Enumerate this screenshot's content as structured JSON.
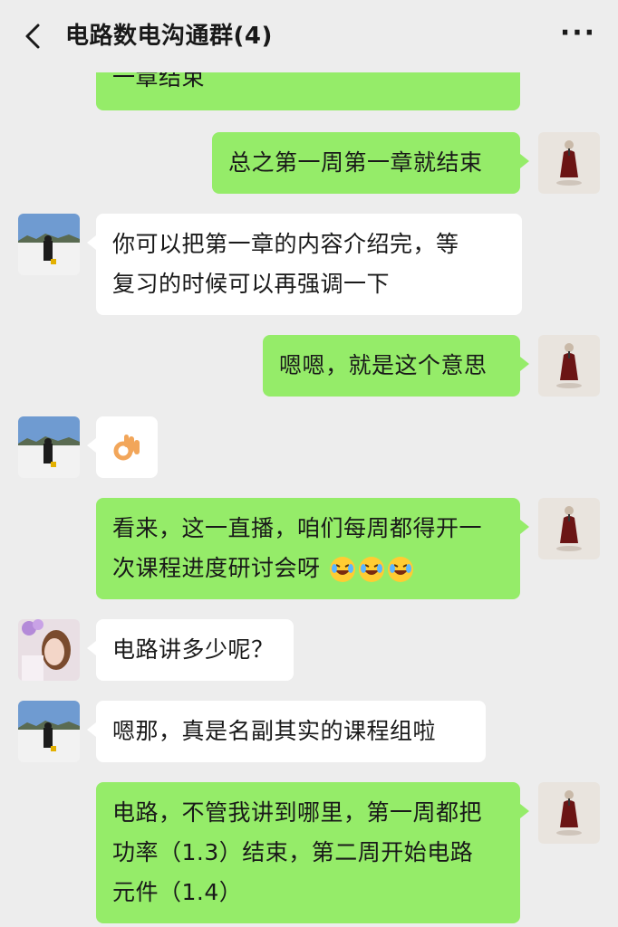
{
  "header": {
    "title": "电路数电沟通群(4)",
    "back_icon": "chevron-left-icon",
    "more_label": "···"
  },
  "messages": [
    {
      "side": "right",
      "type": "text",
      "text": "一章结束"
    },
    {
      "side": "right",
      "type": "text",
      "text": "总之第一周第一章就结束"
    },
    {
      "side": "left",
      "type": "text",
      "lines": [
        "你可以把第一章的内容介绍完，等",
        "复习的时候可以再强调一下"
      ]
    },
    {
      "side": "right",
      "type": "text",
      "text": "嗯嗯，就是这个意思"
    },
    {
      "side": "left",
      "type": "emoji",
      "emoji": "ok-hand-icon"
    },
    {
      "side": "right",
      "type": "text",
      "lines": [
        "看来，这一直播，咱们每周都得开一",
        "次课程进度研讨会呀"
      ],
      "trailing_emoji": "rofl-icon",
      "trailing_emoji_count": 3
    },
    {
      "side": "left",
      "type": "text",
      "text": "电路讲多少呢？"
    },
    {
      "side": "left",
      "type": "text",
      "text": "嗯那，真是名副其实的课程组啦"
    },
    {
      "side": "right",
      "type": "text",
      "lines": [
        "电路，不管我讲到哪里，第一周都把",
        "功率（1.3）结束，第二周开始电路",
        "元件（1.4）"
      ]
    }
  ],
  "colors": {
    "background": "#ededed",
    "green_bubble": "#95ec69",
    "white_bubble": "#ffffff",
    "text": "#191919"
  }
}
